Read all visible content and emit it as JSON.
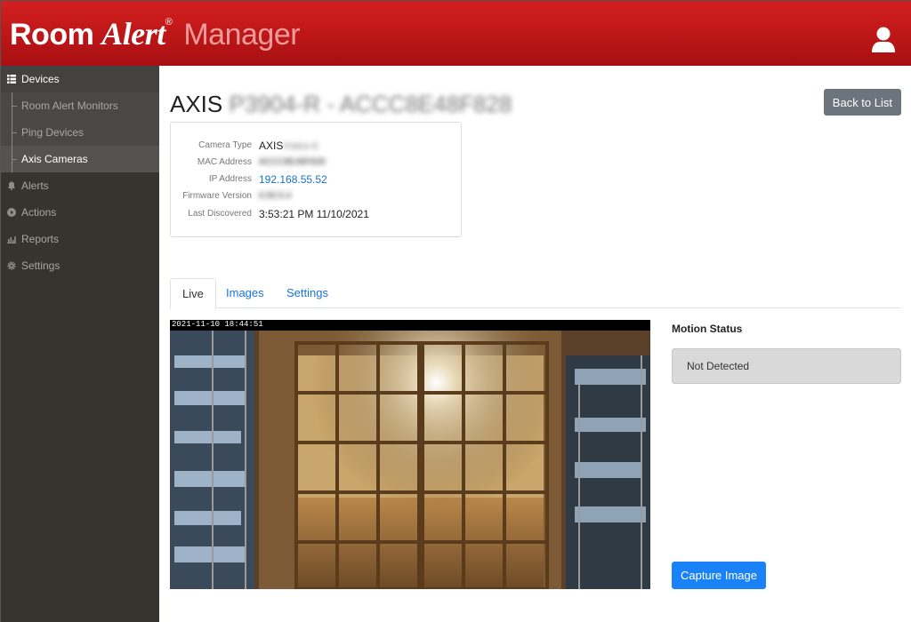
{
  "header": {
    "brand_room": "Room",
    "brand_alert": "Alert",
    "brand_reg": "®",
    "brand_manager": "Manager",
    "user_icon": "user-icon",
    "colors": {
      "bar": "#c41a1a",
      "manager_text": "#f09a9a"
    }
  },
  "sidebar": {
    "devices": {
      "label": "Devices",
      "icon": "list-icon"
    },
    "sub_items": [
      {
        "label": "Room Alert Monitors"
      },
      {
        "label": "Ping Devices"
      },
      {
        "label": "Axis Cameras"
      }
    ],
    "items": [
      {
        "label": "Alerts",
        "icon": "bell-icon"
      },
      {
        "label": "Actions",
        "icon": "play-circle-icon"
      },
      {
        "label": "Reports",
        "icon": "bar-chart-icon"
      },
      {
        "label": "Settings",
        "icon": "gear-icon"
      }
    ]
  },
  "page": {
    "title_brand": "AXIS",
    "title_model": "P3904-R - ACCC8E48F828",
    "back_label": "Back to List"
  },
  "info": {
    "camera_type_label": "Camera Type",
    "camera_type_brand": "AXIS",
    "camera_type_model": "P3904-R",
    "mac_label": "MAC Address",
    "mac_value": "ACCC8E48F828",
    "ip_label": "IP Address",
    "ip_value": "192.168.55.52",
    "firmware_label": "Firmware Version",
    "firmware_value": "6.50.5.4",
    "discovered_label": "Last Discovered",
    "discovered_value": "3:53:21 PM 11/10/2021"
  },
  "tabs": [
    {
      "label": "Live"
    },
    {
      "label": "Images"
    },
    {
      "label": "Settings"
    }
  ],
  "feed": {
    "timestamp": "2021-11-10  18:44:51"
  },
  "motion": {
    "label": "Motion Status",
    "status": "Not Detected"
  },
  "capture_label": "Capture Image"
}
